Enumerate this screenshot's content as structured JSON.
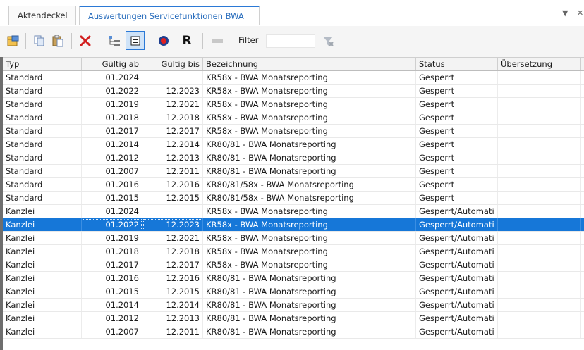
{
  "tabs": {
    "inactive_label": "Aktendeckel",
    "active_label": "Auswertungen Servicefunktionen BWA",
    "menu_glyph": "▼",
    "close_glyph": "✕"
  },
  "toolbar": {
    "r_label": "R",
    "filter_label": "Filter",
    "filter_value": "",
    "icons": [
      "properties-icon",
      "copy-icon",
      "paste-icon",
      "delete-icon",
      "tree-view-icon",
      "details-view-icon",
      "record-icon",
      "r-icon",
      "disabled-icon",
      "filter-clear-icon"
    ]
  },
  "columns": {
    "typ": "Typ",
    "gueltig_ab": "Gültig ab",
    "gueltig_bis": "Gültig bis",
    "bezeichnung": "Bezeichnung",
    "status": "Status",
    "uebersetzung": "Übersetzung"
  },
  "rows": [
    {
      "typ": "Standard",
      "ab": "01.2024",
      "bis": "",
      "bez": "KR58x - BWA Monatsreporting",
      "status": "Gesperrt",
      "ueb": ""
    },
    {
      "typ": "Standard",
      "ab": "01.2022",
      "bis": "12.2023",
      "bez": "KR58x - BWA Monatsreporting",
      "status": "Gesperrt",
      "ueb": ""
    },
    {
      "typ": "Standard",
      "ab": "01.2019",
      "bis": "12.2021",
      "bez": "KR58x - BWA Monatsreporting",
      "status": "Gesperrt",
      "ueb": ""
    },
    {
      "typ": "Standard",
      "ab": "01.2018",
      "bis": "12.2018",
      "bez": "KR58x - BWA Monatsreporting",
      "status": "Gesperrt",
      "ueb": ""
    },
    {
      "typ": "Standard",
      "ab": "01.2017",
      "bis": "12.2017",
      "bez": "KR58x - BWA Monatsreporting",
      "status": "Gesperrt",
      "ueb": ""
    },
    {
      "typ": "Standard",
      "ab": "01.2014",
      "bis": "12.2014",
      "bez": "KR80/81 - BWA Monatsreporting",
      "status": "Gesperrt",
      "ueb": ""
    },
    {
      "typ": "Standard",
      "ab": "01.2012",
      "bis": "12.2013",
      "bez": "KR80/81 - BWA Monatsreporting",
      "status": "Gesperrt",
      "ueb": ""
    },
    {
      "typ": "Standard",
      "ab": "01.2007",
      "bis": "12.2011",
      "bez": "KR80/81 - BWA Monatsreporting",
      "status": "Gesperrt",
      "ueb": ""
    },
    {
      "typ": "Standard",
      "ab": "01.2016",
      "bis": "12.2016",
      "bez": "KR80/81/58x - BWA Monatsreporting",
      "status": "Gesperrt",
      "ueb": ""
    },
    {
      "typ": "Standard",
      "ab": "01.2015",
      "bis": "12.2015",
      "bez": "KR80/81/58x - BWA Monatsreporting",
      "status": "Gesperrt",
      "ueb": ""
    },
    {
      "typ": "Kanzlei",
      "ab": "01.2024",
      "bis": "",
      "bez": "KR58x - BWA Monatsreporting",
      "status": "Gesperrt/Automati",
      "ueb": ""
    },
    {
      "typ": "Kanzlei",
      "ab": "01.2022",
      "bis": "12.2023",
      "bez": "KR58x - BWA Monatsreporting",
      "status": "Gesperrt/Automati",
      "ueb": "",
      "selected": true
    },
    {
      "typ": "Kanzlei",
      "ab": "01.2019",
      "bis": "12.2021",
      "bez": "KR58x - BWA Monatsreporting",
      "status": "Gesperrt/Automati",
      "ueb": ""
    },
    {
      "typ": "Kanzlei",
      "ab": "01.2018",
      "bis": "12.2018",
      "bez": "KR58x - BWA Monatsreporting",
      "status": "Gesperrt/Automati",
      "ueb": ""
    },
    {
      "typ": "Kanzlei",
      "ab": "01.2017",
      "bis": "12.2017",
      "bez": "KR58x - BWA Monatsreporting",
      "status": "Gesperrt/Automati",
      "ueb": ""
    },
    {
      "typ": "Kanzlei",
      "ab": "01.2016",
      "bis": "12.2016",
      "bez": "KR80/81 - BWA Monatsreporting",
      "status": "Gesperrt/Automati",
      "ueb": ""
    },
    {
      "typ": "Kanzlei",
      "ab": "01.2015",
      "bis": "12.2015",
      "bez": "KR80/81 - BWA Monatsreporting",
      "status": "Gesperrt/Automati",
      "ueb": ""
    },
    {
      "typ": "Kanzlei",
      "ab": "01.2014",
      "bis": "12.2014",
      "bez": "KR80/81 - BWA Monatsreporting",
      "status": "Gesperrt/Automati",
      "ueb": ""
    },
    {
      "typ": "Kanzlei",
      "ab": "01.2012",
      "bis": "12.2013",
      "bez": "KR80/81 - BWA Monatsreporting",
      "status": "Gesperrt/Automati",
      "ueb": ""
    },
    {
      "typ": "Kanzlei",
      "ab": "01.2007",
      "bis": "12.2011",
      "bez": "KR80/81 - BWA Monatsreporting",
      "status": "Gesperrt/Automati",
      "ueb": ""
    }
  ],
  "colors": {
    "accent": "#2b79d6",
    "selection": "#1677d8",
    "delete_red": "#d21f1f"
  }
}
